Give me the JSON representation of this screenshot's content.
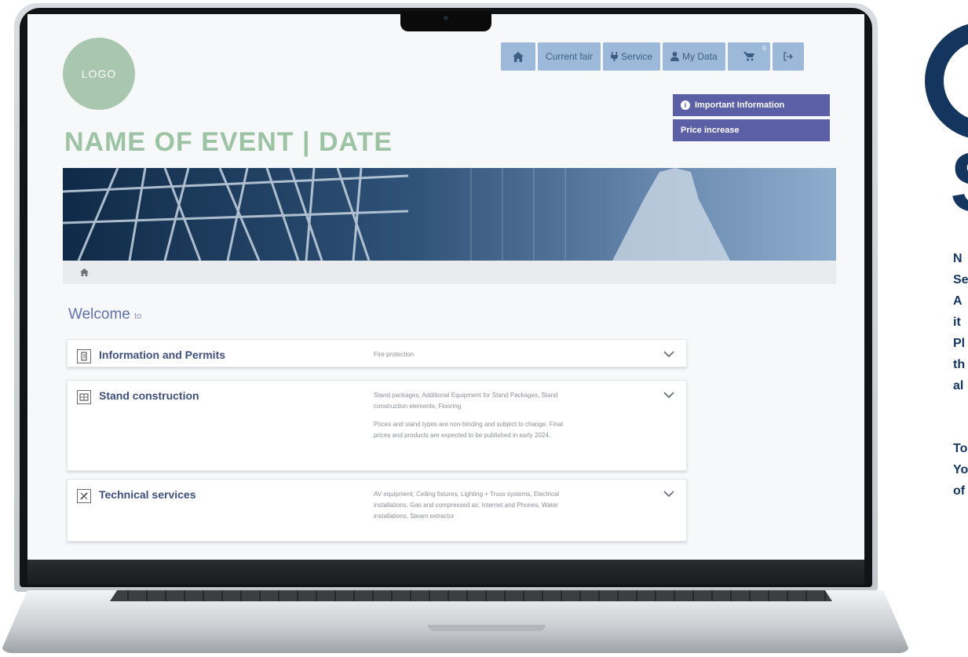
{
  "logo": {
    "text": "LOGO"
  },
  "event": {
    "title": "NAME OF EVENT  |  DATE"
  },
  "nav": {
    "home_icon": "home-icon",
    "current_fair": "Current fair",
    "service": "Service",
    "my_data": "My Data",
    "cart_count": "0",
    "logout_icon": "logout-icon"
  },
  "notices": {
    "important": "Important Information",
    "price": "Price increase"
  },
  "welcome": {
    "main": "Welcome",
    "suffix": "to"
  },
  "sections": [
    {
      "title": "Information and Permits",
      "desc": [
        "Fire protection"
      ]
    },
    {
      "title": "Stand construction",
      "desc": [
        "Stand packages, Additional Equipment for Stand Packages, Stand construction elements, Flooring",
        "Prices and stand types are non-binding and subject to change. Final prices and products are expected to be published in early 2024."
      ]
    },
    {
      "title": "Technical services",
      "desc": [
        "AV equipment, Ceiling fixtures, Lighting + Truss systems, Electrical installations, Gas and compressed air, Internet and Phones, Water installations, Steam extractor"
      ]
    }
  ],
  "side": {
    "letter": "S",
    "lines_a": [
      "N",
      "Se",
      "A",
      "it",
      "Pl",
      "th",
      "al"
    ],
    "lines_b": [
      "To",
      "Yo",
      "of"
    ]
  },
  "colors": {
    "nav": "#9cb9d9",
    "notice": "#5a5fa6",
    "title_green": "#9dc3a5",
    "side_navy": "#14355e"
  }
}
